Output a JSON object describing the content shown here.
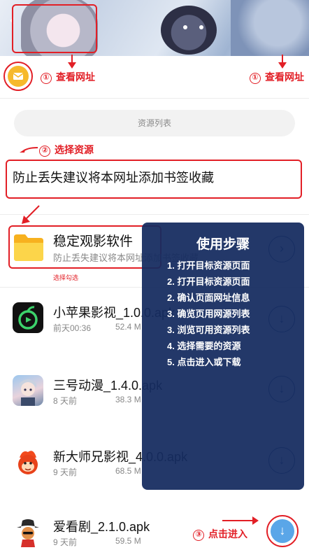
{
  "header": {
    "back_icon": "back-arrow-icon"
  },
  "annotations": {
    "view_url_left": "查看网址",
    "view_url_right": "查看网址",
    "select_resource": "选择资源",
    "click_enter": "点击进入",
    "num1": "①",
    "num2": "②",
    "num3": "③",
    "red_color": "#e21f26"
  },
  "resource_list_button": "资源列表",
  "notice": "防止丢失建议将本网址添加书签收藏",
  "folder_item": {
    "name": "稳定观影软件",
    "desc": "防止丢失建议将本网址添加书签收藏",
    "tag": "选择勾选",
    "icon": "folder-icon"
  },
  "apps": [
    {
      "name": "小苹果影视_1.0.0.apk",
      "time": "前天00:36",
      "size": "52.4 M",
      "icon": "apple-app-icon"
    },
    {
      "name": "三号动漫_1.4.0.apk",
      "time": "8 天前",
      "size": "38.3 M",
      "icon": "anime-app-icon"
    },
    {
      "name": "新大师兄影视_4.0.0.apk",
      "time": "9 天前",
      "size": "68.5 M",
      "icon": "monkey-app-icon"
    },
    {
      "name": "爱看剧_2.1.0.apk",
      "time": "9 天前",
      "size": "59.5 M",
      "icon": "cowboy-app-icon"
    }
  ],
  "guide": {
    "title": "使用步骤",
    "steps": [
      "1. 打开目标资源页面",
      "2. 打开目标资源页面",
      "2. 确认页面网址信息",
      "3. 确览页用网源列表",
      "3. 浏览可用资源列表",
      "4. 选择需要的资源",
      "5. 点击进入或下载"
    ]
  }
}
